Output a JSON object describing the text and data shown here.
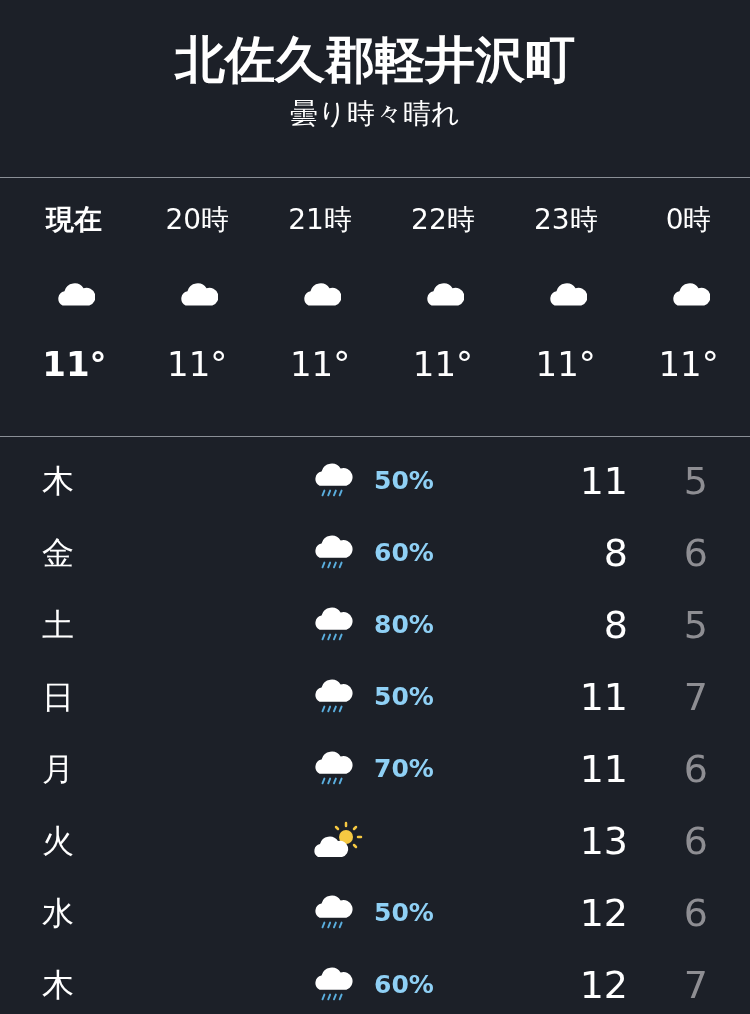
{
  "location": {
    "title": "北佐久郡軽井沢町",
    "condition": "曇り時々晴れ"
  },
  "hourly": [
    {
      "kind": "now",
      "label": "現在",
      "temp": "11°"
    },
    {
      "kind": "hour",
      "label": "20時",
      "temp": "11°"
    },
    {
      "kind": "hour",
      "label": "21時",
      "temp": "11°"
    },
    {
      "kind": "hour",
      "label": "22時",
      "temp": "11°"
    },
    {
      "kind": "hour",
      "label": "23時",
      "temp": "11°"
    },
    {
      "kind": "hour",
      "label": "0時",
      "temp": "11°"
    }
  ],
  "daily": [
    {
      "kind": "rain",
      "day": "木",
      "chance": "50%",
      "high": "11",
      "low": "5"
    },
    {
      "kind": "rain",
      "day": "金",
      "chance": "60%",
      "high": "8",
      "low": "6"
    },
    {
      "kind": "rain",
      "day": "土",
      "chance": "80%",
      "high": "8",
      "low": "5"
    },
    {
      "kind": "rain",
      "day": "日",
      "chance": "50%",
      "high": "11",
      "low": "7"
    },
    {
      "kind": "rain",
      "day": "月",
      "chance": "70%",
      "high": "11",
      "low": "6"
    },
    {
      "kind": "partly_sunny",
      "day": "火",
      "high": "13",
      "low": "6"
    },
    {
      "kind": "rain",
      "day": "水",
      "chance": "50%",
      "high": "12",
      "low": "6"
    },
    {
      "kind": "rain",
      "day": "木",
      "chance": "60%",
      "high": "12",
      "low": "7"
    }
  ]
}
